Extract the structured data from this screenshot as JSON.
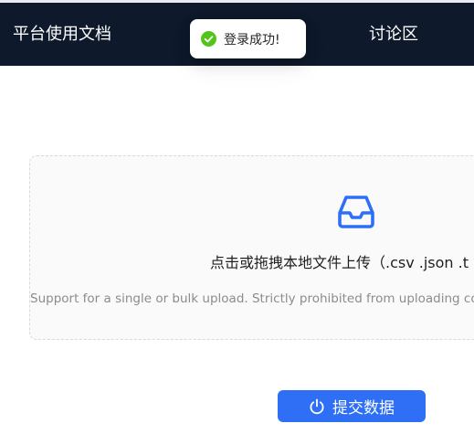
{
  "nav": {
    "docs_label": "平台使用文档",
    "forum_label": "讨论区"
  },
  "toast": {
    "message": "登录成功!",
    "icon": "check-circle-icon",
    "color": "#52c41a"
  },
  "upload": {
    "icon": "inbox-icon",
    "hint": "点击或拖拽本地文件上传（.csv .json .t",
    "subtext": "Support for a single or bulk upload. Strictly prohibited from uploading co"
  },
  "submit": {
    "label": "提交数据",
    "icon": "power-icon",
    "color": "#2f6ff5"
  },
  "colors": {
    "navbar_bg": "#0e1a2b",
    "accent": "#2f6ff5"
  }
}
